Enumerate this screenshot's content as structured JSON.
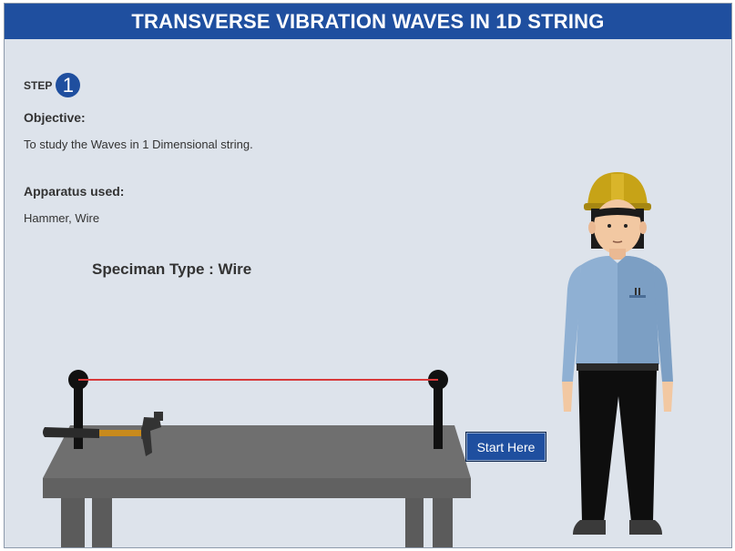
{
  "title": "TRANSVERSE VIBRATION WAVES IN 1D STRING",
  "step": {
    "label": "STEP",
    "number": "1"
  },
  "objective": {
    "heading": "Objective:",
    "text": "To study the Waves in 1 Dimensional string."
  },
  "apparatus": {
    "heading": "Apparatus used:",
    "text": "Hammer, Wire"
  },
  "speciman": "Speciman Type : Wire",
  "start_button": "Start Here",
  "colors": {
    "header": "#1f4f9f",
    "background": "#dde3eb",
    "wire": "#d83a3a",
    "table": "#6e6e6e"
  }
}
